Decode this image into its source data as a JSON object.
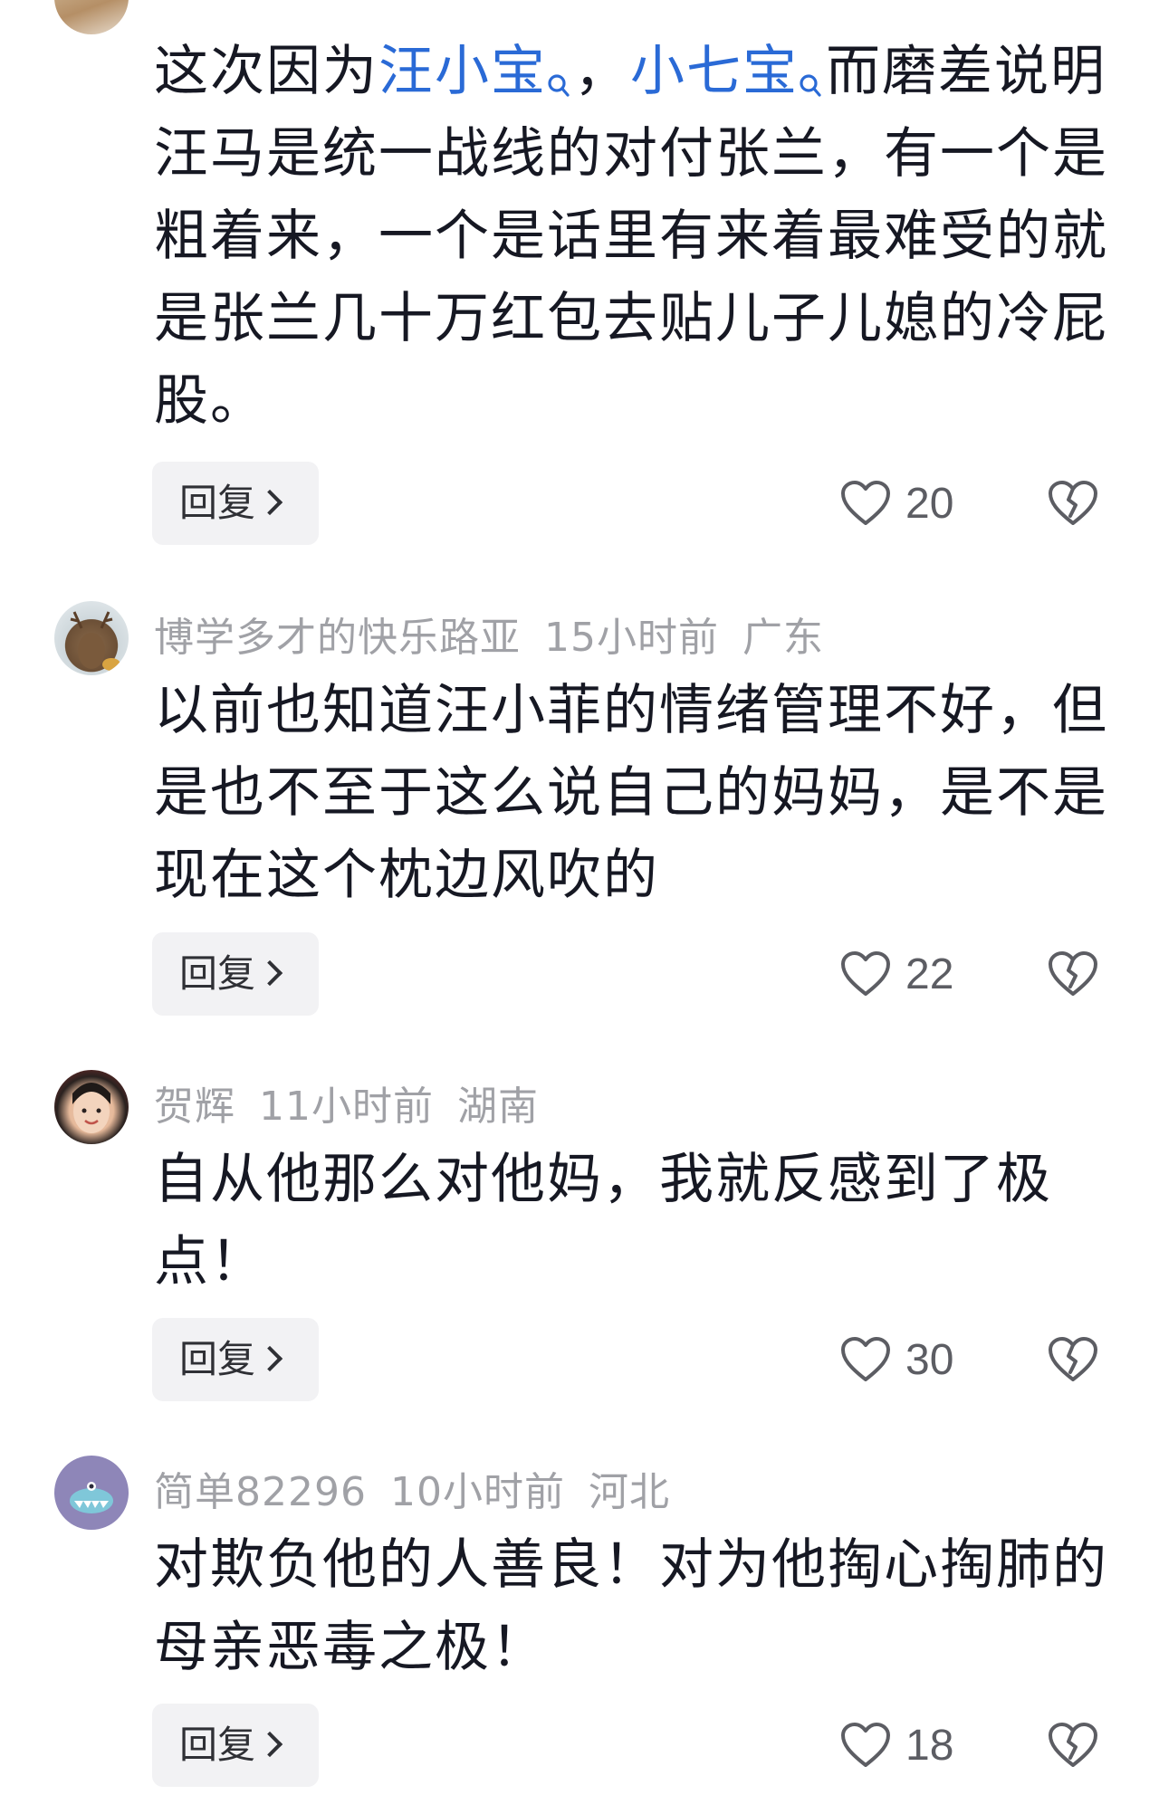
{
  "comments": [
    {
      "text_before": "这次因为",
      "mention1": "汪小宝",
      "text_mid": "，",
      "mention2": "小七宝",
      "text_after": "而磨差说明汪马是统一战线的对付张兰，有一个是粗着来，一个是话里有来着最难受的就是张兰几十万红包去贴儿子儿媳的冷屁股。",
      "reply_label": "回复",
      "likes": "20"
    },
    {
      "username": "博学多才的快乐路亚",
      "time": "15小时前",
      "location": "广东",
      "text": "以前也知道汪小菲的情绪管理不好，但是也不至于这么说自己的妈妈，是不是现在这个枕边风吹的",
      "reply_label": "回复",
      "likes": "22"
    },
    {
      "username": "贺辉",
      "time": "11小时前",
      "location": "湖南",
      "text": "自从他那么对他妈，我就反感到了极点！",
      "reply_label": "回复",
      "likes": "30"
    },
    {
      "username": "简单82296",
      "time": "10小时前",
      "location": "河北",
      "text": "对欺负他的人善良！对为他掏心掏肺的母亲恶毒之极！",
      "reply_label": "回复",
      "likes": "18"
    }
  ],
  "icons": {
    "like": "heart-outline-icon",
    "dislike": "broken-heart-icon",
    "mention": "search-icon"
  },
  "colors": {
    "mention": "#2a6ad6",
    "meta": "#a0a1a6",
    "text": "#161823"
  }
}
